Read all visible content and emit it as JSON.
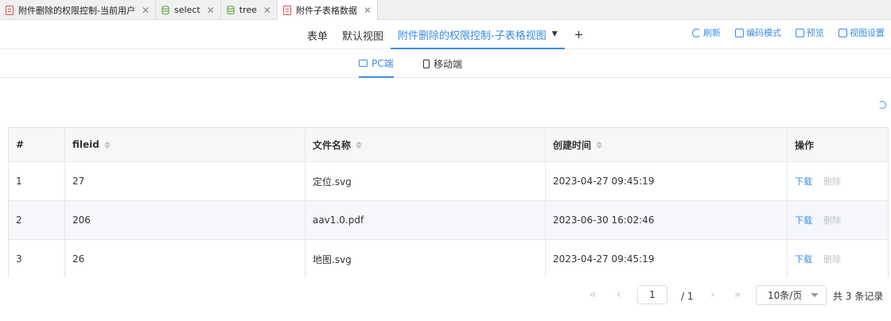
{
  "tabs": [
    {
      "label": "附件删除的权限控制-当前用户",
      "icon": "document-icon",
      "active": false
    },
    {
      "label": "select",
      "icon": "database-icon",
      "active": false
    },
    {
      "label": "tree",
      "icon": "database-icon",
      "active": false
    },
    {
      "label": "附件子表格数据",
      "icon": "document-icon",
      "active": true
    }
  ],
  "tab_close_glyph": "✕",
  "views": {
    "items": [
      "表单",
      "默认视图",
      "附件删除的权限控制-子表格视图"
    ],
    "add": "+"
  },
  "actions": {
    "refresh": "刷新",
    "code_mode": "编码模式",
    "preview": "预览",
    "view_settings": "视图设置"
  },
  "devices": {
    "pc": "PC端",
    "mobile": "移动端"
  },
  "table": {
    "headers": [
      "#",
      "fileid",
      "文件名称",
      "创建时间",
      "操作"
    ],
    "rows": [
      {
        "idx": "1",
        "fileid": "27",
        "name": "定位.svg",
        "created": "2023-04-27 09:45:19"
      },
      {
        "idx": "2",
        "fileid": "206",
        "name": "aav1.0.pdf",
        "created": "2023-06-30 16:02:46"
      },
      {
        "idx": "3",
        "fileid": "26",
        "name": "地图.svg",
        "created": "2023-04-27 09:45:19"
      }
    ],
    "op_download": "下载",
    "op_delete": "删除"
  },
  "pager": {
    "first": "«",
    "prev": "‹",
    "next": "›",
    "last": "»",
    "current": "1",
    "total_pages": "/ 1",
    "page_size": "10条/页",
    "total_records": "共 3 条记录"
  },
  "colors": {
    "accent": "#3a8ee6",
    "tab_icon_doc": "#e0525a",
    "tab_icon_db": "#6ab04c"
  }
}
